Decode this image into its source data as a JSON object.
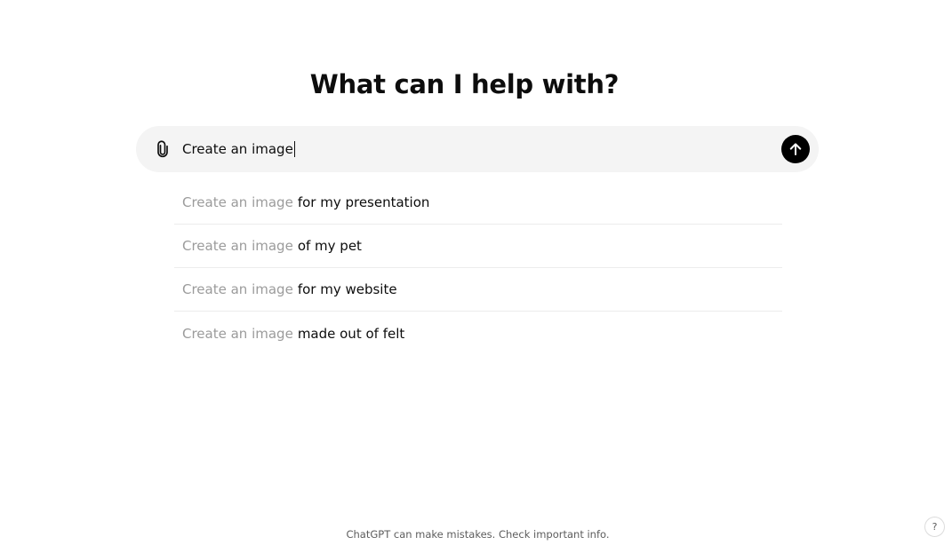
{
  "heading": "What can I help with?",
  "composer": {
    "value": "Create an image",
    "attach_icon": "paperclip-icon",
    "send_icon": "arrow-up-icon"
  },
  "suggestions": [
    {
      "prefix": "Create an image",
      "rest": "for my presentation"
    },
    {
      "prefix": "Create an image",
      "rest": "of my pet"
    },
    {
      "prefix": "Create an image",
      "rest": "for my website"
    },
    {
      "prefix": "Create an image",
      "rest": "made out of felt"
    }
  ],
  "footer": {
    "note": "ChatGPT can make mistakes. Check important info."
  },
  "help": {
    "label": "?"
  },
  "colors": {
    "composer_bg": "#f4f4f4",
    "send_bg": "#000000",
    "muted_text": "#9b9b9b",
    "text": "#0d0d0d"
  }
}
